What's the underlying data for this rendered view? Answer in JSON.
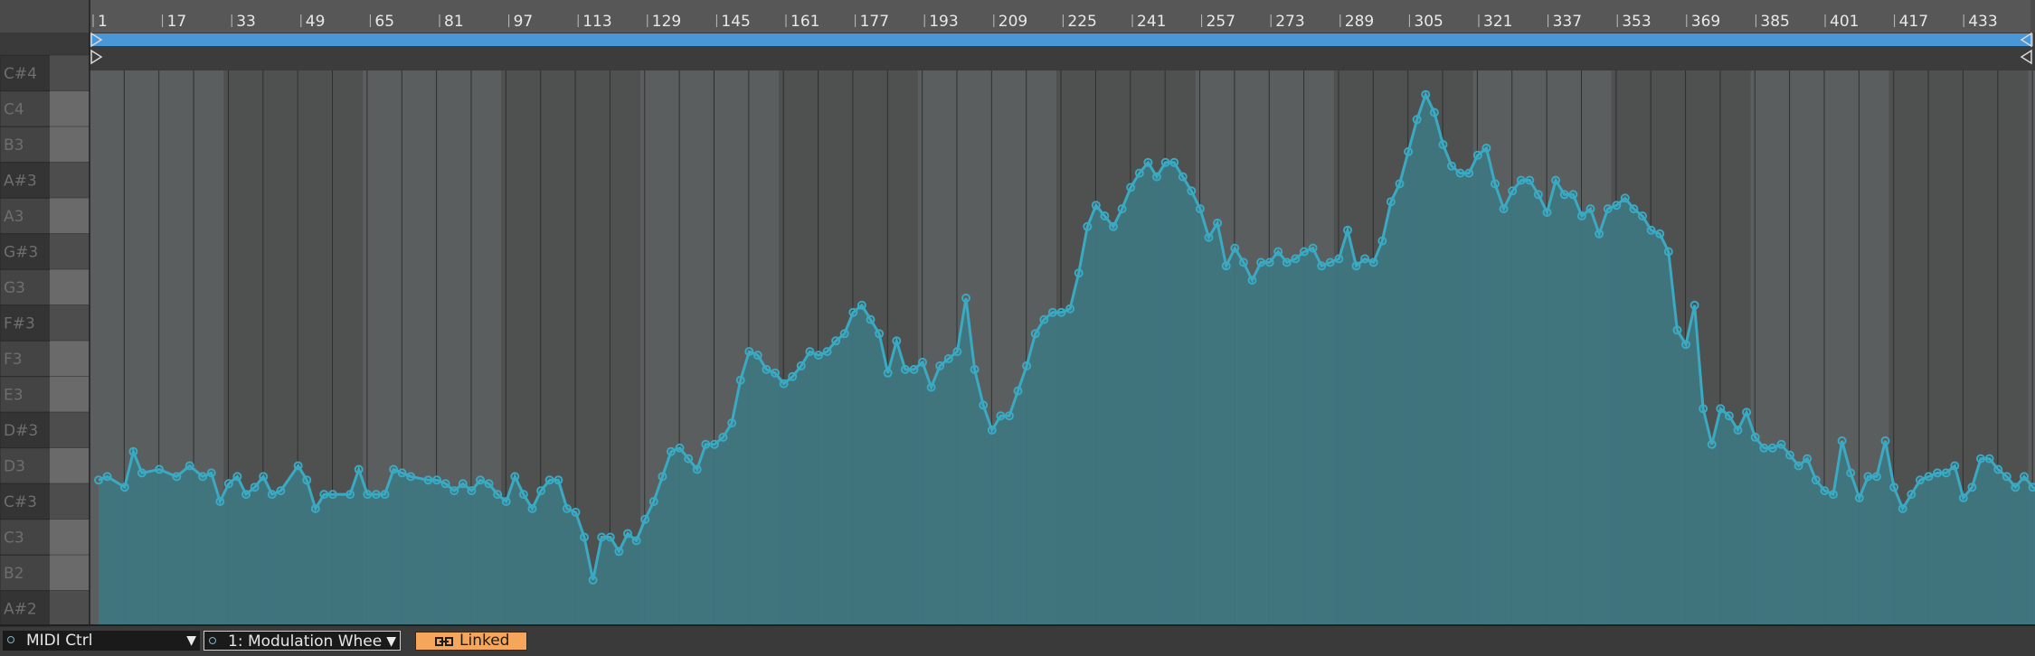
{
  "ruler": {
    "bar_labels": [
      "1",
      "17",
      "33",
      "49",
      "65",
      "81",
      "97",
      "113",
      "129",
      "145",
      "161",
      "177",
      "193",
      "209",
      "225",
      "241",
      "257",
      "273",
      "289",
      "305",
      "321",
      "337",
      "353",
      "369",
      "385",
      "401",
      "417",
      "433"
    ]
  },
  "piano": {
    "notes": [
      "C#4",
      "C4",
      "B3",
      "A#3",
      "A3",
      "G#3",
      "G3",
      "F#3",
      "F3",
      "E3",
      "D#3",
      "D3",
      "C#3",
      "C3",
      "B2",
      "A#2"
    ]
  },
  "envelope": {
    "color": "#3aa9c2",
    "fill_color": "#3f7680",
    "x_unit": "bar",
    "y_unit": "pitch-row",
    "x_range": [
      1,
      449
    ],
    "y_range_rows": [
      0.5,
      15.8
    ],
    "points": [
      [
        1,
        11.4
      ],
      [
        3,
        11.3
      ],
      [
        7,
        11.6
      ],
      [
        9,
        10.6
      ],
      [
        11,
        11.2
      ],
      [
        15,
        11.1
      ],
      [
        19,
        11.3
      ],
      [
        22,
        11.0
      ],
      [
        25,
        11.3
      ],
      [
        27,
        11.2
      ],
      [
        29,
        12.0
      ],
      [
        31,
        11.5
      ],
      [
        33,
        11.3
      ],
      [
        35,
        11.8
      ],
      [
        37,
        11.6
      ],
      [
        39,
        11.3
      ],
      [
        41,
        11.8
      ],
      [
        43,
        11.7
      ],
      [
        47,
        11.0
      ],
      [
        49,
        11.4
      ],
      [
        51,
        12.2
      ],
      [
        53,
        11.8
      ],
      [
        55,
        11.8
      ],
      [
        59,
        11.8
      ],
      [
        61,
        11.1
      ],
      [
        63,
        11.8
      ],
      [
        65,
        11.8
      ],
      [
        67,
        11.8
      ],
      [
        69,
        11.1
      ],
      [
        71,
        11.2
      ],
      [
        73,
        11.3
      ],
      [
        77,
        11.4
      ],
      [
        79,
        11.4
      ],
      [
        81,
        11.5
      ],
      [
        83,
        11.7
      ],
      [
        85,
        11.5
      ],
      [
        87,
        11.7
      ],
      [
        89,
        11.4
      ],
      [
        91,
        11.5
      ],
      [
        93,
        11.8
      ],
      [
        95,
        12.0
      ],
      [
        97,
        11.3
      ],
      [
        99,
        11.8
      ],
      [
        101,
        12.2
      ],
      [
        103,
        11.7
      ],
      [
        105,
        11.4
      ],
      [
        107,
        11.4
      ],
      [
        109,
        12.2
      ],
      [
        111,
        12.3
      ],
      [
        113,
        13.0
      ],
      [
        115,
        14.2
      ],
      [
        117,
        13.0
      ],
      [
        119,
        13.0
      ],
      [
        121,
        13.4
      ],
      [
        123,
        12.9
      ],
      [
        125,
        13.1
      ],
      [
        127,
        12.5
      ],
      [
        129,
        12.0
      ],
      [
        131,
        11.3
      ],
      [
        133,
        10.6
      ],
      [
        135,
        10.5
      ],
      [
        137,
        10.8
      ],
      [
        139,
        11.1
      ],
      [
        141,
        10.4
      ],
      [
        143,
        10.4
      ],
      [
        145,
        10.2
      ],
      [
        147,
        9.8
      ],
      [
        149,
        8.6
      ],
      [
        151,
        7.8
      ],
      [
        153,
        7.9
      ],
      [
        155,
        8.3
      ],
      [
        157,
        8.4
      ],
      [
        159,
        8.7
      ],
      [
        161,
        8.5
      ],
      [
        163,
        8.2
      ],
      [
        165,
        7.8
      ],
      [
        167,
        7.9
      ],
      [
        169,
        7.8
      ],
      [
        171,
        7.5
      ],
      [
        173,
        7.3
      ],
      [
        175,
        6.7
      ],
      [
        177,
        6.5
      ],
      [
        179,
        6.9
      ],
      [
        181,
        7.3
      ],
      [
        183,
        8.4
      ],
      [
        185,
        7.5
      ],
      [
        187,
        8.3
      ],
      [
        189,
        8.3
      ],
      [
        191,
        8.1
      ],
      [
        193,
        8.8
      ],
      [
        195,
        8.2
      ],
      [
        197,
        8.0
      ],
      [
        199,
        7.8
      ],
      [
        201,
        6.3
      ],
      [
        203,
        8.3
      ],
      [
        205,
        9.3
      ],
      [
        207,
        10.0
      ],
      [
        209,
        9.6
      ],
      [
        211,
        9.6
      ],
      [
        213,
        8.9
      ],
      [
        215,
        8.2
      ],
      [
        217,
        7.3
      ],
      [
        219,
        6.9
      ],
      [
        221,
        6.7
      ],
      [
        223,
        6.7
      ],
      [
        225,
        6.6
      ],
      [
        227,
        5.6
      ],
      [
        229,
        4.3
      ],
      [
        231,
        3.7
      ],
      [
        233,
        4.0
      ],
      [
        235,
        4.3
      ],
      [
        237,
        3.8
      ],
      [
        239,
        3.2
      ],
      [
        241,
        2.8
      ],
      [
        243,
        2.5
      ],
      [
        245,
        2.9
      ],
      [
        247,
        2.5
      ],
      [
        249,
        2.5
      ],
      [
        251,
        2.9
      ],
      [
        253,
        3.3
      ],
      [
        255,
        3.8
      ],
      [
        257,
        4.6
      ],
      [
        259,
        4.2
      ],
      [
        261,
        5.4
      ],
      [
        263,
        4.9
      ],
      [
        265,
        5.3
      ],
      [
        267,
        5.8
      ],
      [
        269,
        5.3
      ],
      [
        271,
        5.3
      ],
      [
        273,
        5.0
      ],
      [
        275,
        5.3
      ],
      [
        277,
        5.2
      ],
      [
        279,
        5.0
      ],
      [
        281,
        4.9
      ],
      [
        283,
        5.4
      ],
      [
        285,
        5.3
      ],
      [
        287,
        5.2
      ],
      [
        289,
        4.4
      ],
      [
        291,
        5.4
      ],
      [
        293,
        5.2
      ],
      [
        295,
        5.3
      ],
      [
        297,
        4.7
      ],
      [
        299,
        3.6
      ],
      [
        301,
        3.1
      ],
      [
        303,
        2.2
      ],
      [
        305,
        1.3
      ],
      [
        307,
        0.6
      ],
      [
        309,
        1.1
      ],
      [
        311,
        2.0
      ],
      [
        313,
        2.6
      ],
      [
        315,
        2.8
      ],
      [
        317,
        2.8
      ],
      [
        319,
        2.3
      ],
      [
        321,
        2.1
      ],
      [
        323,
        3.1
      ],
      [
        325,
        3.8
      ],
      [
        327,
        3.3
      ],
      [
        329,
        3.0
      ],
      [
        331,
        3.0
      ],
      [
        333,
        3.4
      ],
      [
        335,
        3.9
      ],
      [
        337,
        3.0
      ],
      [
        339,
        3.4
      ],
      [
        341,
        3.4
      ],
      [
        343,
        4.0
      ],
      [
        345,
        3.8
      ],
      [
        347,
        4.5
      ],
      [
        349,
        3.8
      ],
      [
        351,
        3.7
      ],
      [
        353,
        3.5
      ],
      [
        355,
        3.8
      ],
      [
        357,
        4.0
      ],
      [
        359,
        4.4
      ],
      [
        361,
        4.5
      ],
      [
        363,
        5.0
      ],
      [
        365,
        7.2
      ],
      [
        367,
        7.6
      ],
      [
        369,
        6.5
      ],
      [
        371,
        9.4
      ],
      [
        373,
        10.4
      ],
      [
        375,
        9.4
      ],
      [
        377,
        9.6
      ],
      [
        379,
        10.0
      ],
      [
        381,
        9.5
      ],
      [
        383,
        10.2
      ],
      [
        385,
        10.5
      ],
      [
        387,
        10.5
      ],
      [
        389,
        10.4
      ],
      [
        391,
        10.7
      ],
      [
        393,
        11.0
      ],
      [
        395,
        10.8
      ],
      [
        397,
        11.4
      ],
      [
        399,
        11.7
      ],
      [
        401,
        11.8
      ],
      [
        403,
        10.3
      ],
      [
        405,
        11.2
      ],
      [
        407,
        11.9
      ],
      [
        409,
        11.3
      ],
      [
        411,
        11.3
      ],
      [
        413,
        10.3
      ],
      [
        415,
        11.6
      ],
      [
        417,
        12.2
      ],
      [
        419,
        11.8
      ],
      [
        421,
        11.4
      ],
      [
        423,
        11.3
      ],
      [
        425,
        11.2
      ],
      [
        427,
        11.2
      ],
      [
        429,
        11.0
      ],
      [
        431,
        11.9
      ],
      [
        433,
        11.6
      ],
      [
        435,
        10.8
      ],
      [
        437,
        10.8
      ],
      [
        439,
        11.1
      ],
      [
        441,
        11.3
      ],
      [
        443,
        11.6
      ],
      [
        445,
        11.3
      ],
      [
        447,
        11.6
      ],
      [
        449,
        11.8
      ]
    ]
  },
  "footer": {
    "device_chooser": "MIDI Ctrl",
    "control_chooser": "1: Modulation Whee",
    "linked_label": "Linked"
  }
}
